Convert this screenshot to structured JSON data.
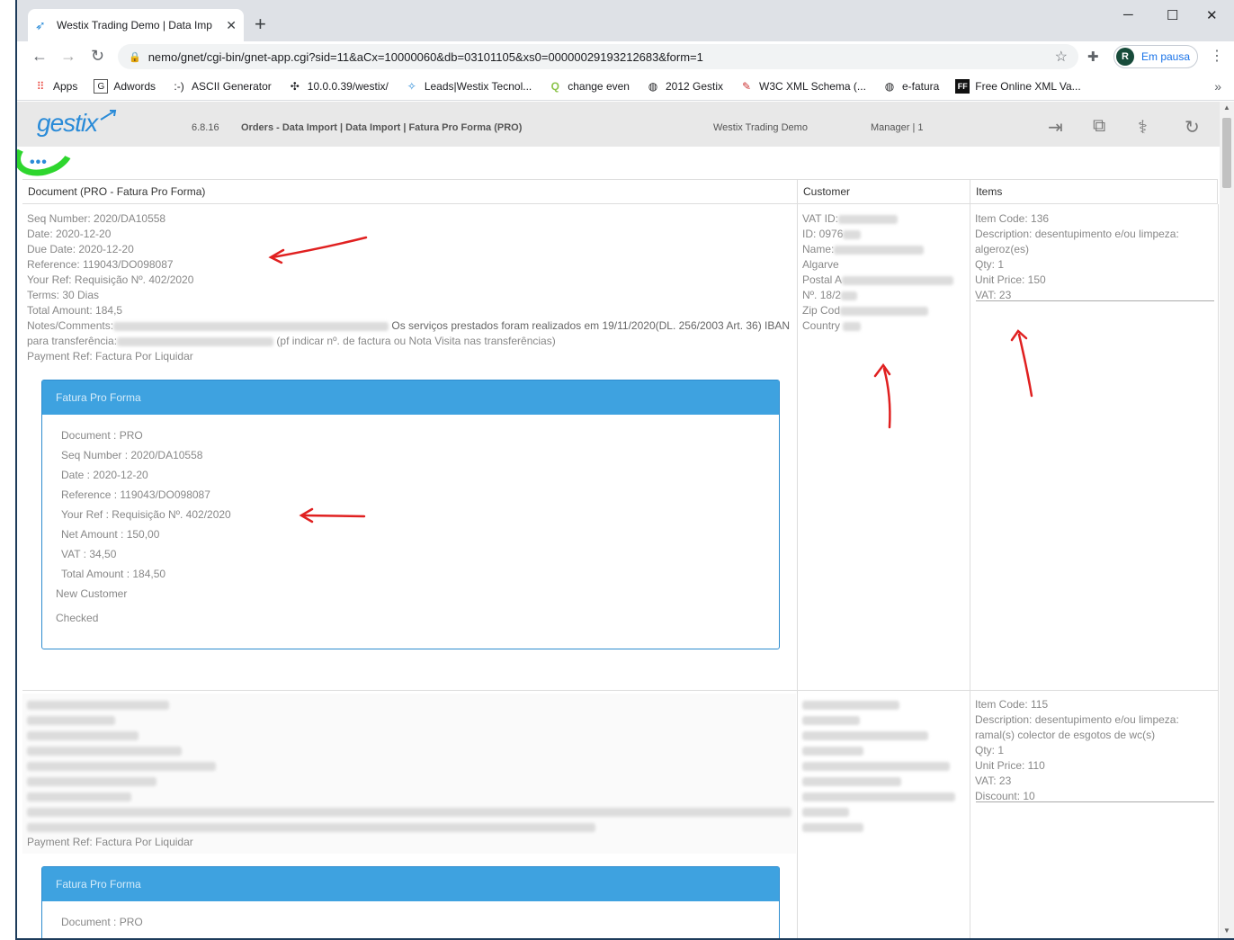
{
  "browser": {
    "tab_title": "Westix Trading Demo | Data Imp",
    "url": "nemo/gnet/cgi-bin/gnet-app.cgi?sid=11&aCx=10000060&db=03101105&xs0=00000029193212683&form=1",
    "profile_initial": "R",
    "profile_status": "Em pausa",
    "bookmarks": [
      {
        "label": "Apps",
        "icon": "apps-grid-icon"
      },
      {
        "label": "Adwords",
        "icon": "google-icon"
      },
      {
        "label": "ASCII Generator",
        "icon": "smiley-icon"
      },
      {
        "label": "10.0.0.39/westix/",
        "icon": "fan-icon"
      },
      {
        "label": "Leads|Westix Tecnol...",
        "icon": "sparkle-icon"
      },
      {
        "label": "change even",
        "icon": "q-icon"
      },
      {
        "label": "2012 Gestix",
        "icon": "globe-icon"
      },
      {
        "label": "W3C XML Schema (...",
        "icon": "w3c-icon"
      },
      {
        "label": "e-fatura",
        "icon": "globe-icon"
      },
      {
        "label": "Free Online XML Va...",
        "icon": "ff-icon"
      }
    ],
    "bookmarks_more": "»"
  },
  "header": {
    "logo": "gestix",
    "version": "6.8.16",
    "breadcrumb": "Orders - Data Import | Data Import | Fatura Pro Forma (PRO)",
    "company": "Westix Trading Demo",
    "user": "Manager | 1",
    "more": "•••"
  },
  "columns": {
    "document": "Document  (PRO - Fatura Pro Forma)",
    "customer": "Customer",
    "items": "Items"
  },
  "rows": [
    {
      "doc_lines": [
        "Seq Number: 2020/DA10558",
        "Date: 2020-12-20",
        "Due Date: 2020-12-20",
        "Reference: 119043/DO098087",
        "Your Ref: Requisição Nº. 402/2020",
        "Terms: 30 Dias",
        "Total Amount: 184,5"
      ],
      "notes_label": "Notes/Comments:",
      "notes_text": "Os serviços prestados foram realizados em 19/11/2020(DL. 256/2003 Art. 36) IBAN",
      "notes_line2_label": "para transferência:",
      "notes_line2_text": "(pf indicar nº. de factura ou Nota Visita nas transferências)",
      "payment_ref": "Payment Ref: Factura Por Liquidar",
      "customer": {
        "vat": "VAT ID:",
        "id": "ID: 0976",
        "name": "Name:",
        "region": "Algarve",
        "postal": "Postal A",
        "no": "Nº. 18/2",
        "zip": "Zip Cod",
        "country": "Country"
      },
      "items": [
        "Item Code: 136",
        "Description: desentupimento e/ou limpeza:",
        "algeroz(es)",
        "Qty: 1",
        "Unit Price: 150",
        "VAT: 23"
      ],
      "proforma": {
        "title": "Fatura Pro Forma",
        "lines": [
          "Document  : PRO",
          "Seq Number  : 2020/DA10558",
          "Date  : 2020-12-20",
          "Reference  : 119043/DO098087",
          "Your Ref  : Requisição Nº. 402/2020",
          "Net Amount  : 150,00",
          "VAT  : 34,50",
          "Total Amount  : 184,50"
        ],
        "new_customer": "New Customer",
        "checked": "Checked"
      }
    },
    {
      "payment_ref": "Payment Ref: Factura Por Liquidar",
      "items": [
        "Item Code: 115",
        "Description: desentupimento e/ou limpeza:",
        "ramal(s) colector de esgotos de wc(s)",
        "Qty: 1",
        "Unit Price: 110",
        "VAT: 23",
        "Discount: 10"
      ],
      "proforma": {
        "title": "Fatura Pro Forma",
        "first_line": "Document  : PRO"
      }
    }
  ],
  "colors": {
    "accent": "#3ea2e0",
    "annotation_red": "#e02020",
    "annotation_green": "#2ed62e"
  }
}
